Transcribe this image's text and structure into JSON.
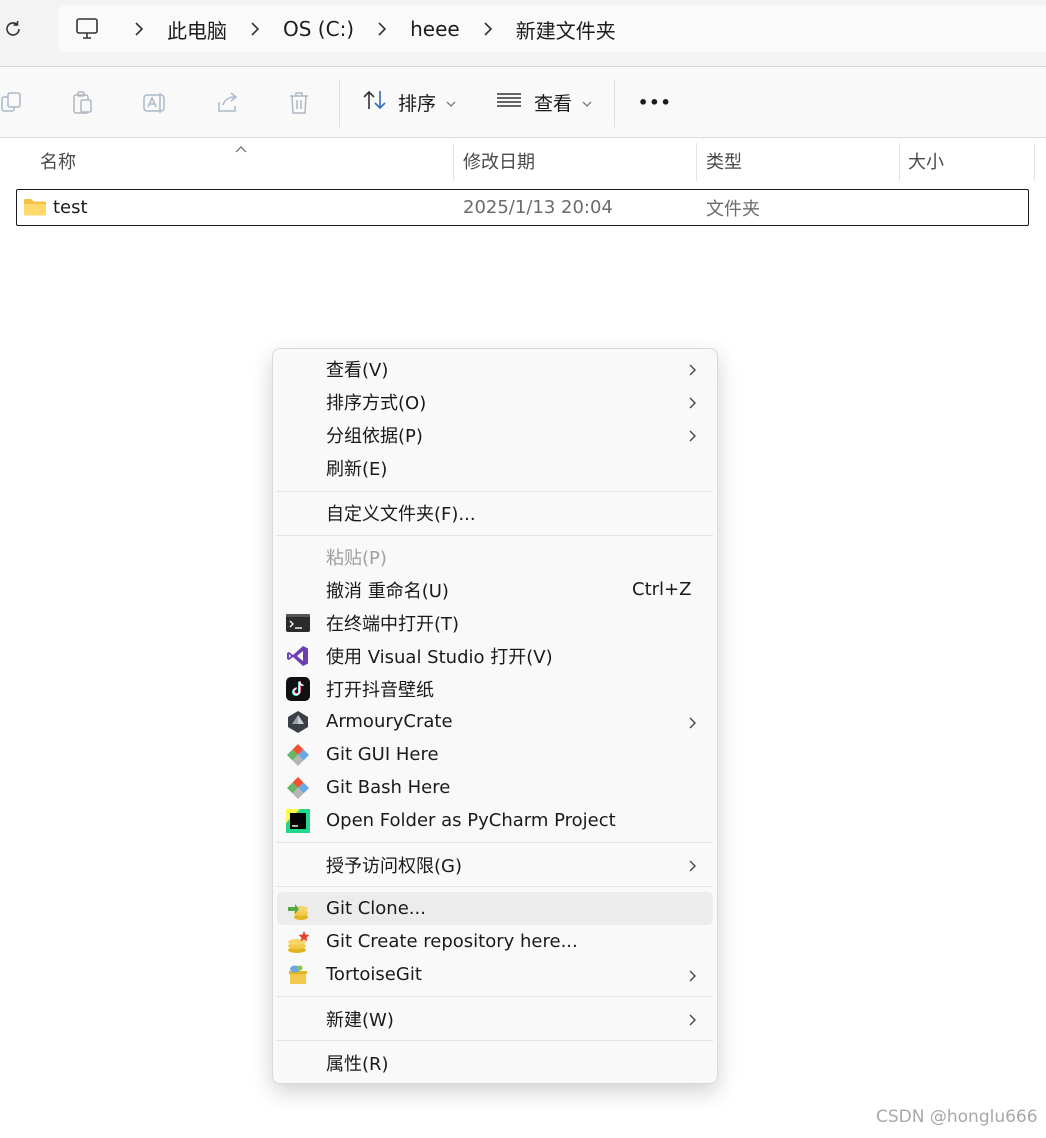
{
  "breadcrumb": {
    "icon": "computer-icon",
    "items": [
      "此电脑",
      "OS (C:)",
      "heee",
      "新建文件夹"
    ]
  },
  "toolbar": {
    "icons": [
      "copy-icon",
      "paste-icon",
      "rename-icon",
      "share-icon",
      "delete-icon"
    ],
    "sort_label": "排序",
    "view_label": "查看",
    "more_label": "•••"
  },
  "columns": {
    "name": "名称",
    "modified": "修改日期",
    "type": "类型",
    "size": "大小"
  },
  "files": [
    {
      "name": "test",
      "modified": "2025/1/13 20:04",
      "type": "文件夹",
      "size": ""
    }
  ],
  "context_menu": {
    "items": [
      {
        "label": "查看(V)",
        "submenu": true
      },
      {
        "label": "排序方式(O)",
        "submenu": true
      },
      {
        "label": "分组依据(P)",
        "submenu": true
      },
      {
        "label": "刷新(E)"
      },
      {
        "label": "自定义文件夹(F)..."
      },
      {
        "label": "粘贴(P)",
        "disabled": true
      },
      {
        "label": "撤消 重命名(U)",
        "shortcut": "Ctrl+Z"
      },
      {
        "label": "在终端中打开(T)",
        "icon": "terminal-icon"
      },
      {
        "label": "使用 Visual Studio 打开(V)",
        "icon": "visual-studio-icon"
      },
      {
        "label": "打开抖音壁纸",
        "icon": "douyin-icon"
      },
      {
        "label": "ArmouryCrate",
        "icon": "armoury-crate-icon",
        "submenu": true
      },
      {
        "label": "Git GUI Here",
        "icon": "git-icon"
      },
      {
        "label": "Git Bash Here",
        "icon": "git-icon"
      },
      {
        "label": "Open Folder as PyCharm Project",
        "icon": "pycharm-icon"
      },
      {
        "label": "授予访问权限(G)",
        "submenu": true
      },
      {
        "label": "Git Clone...",
        "icon": "tortoisegit-clone-icon",
        "highlighted": true
      },
      {
        "label": "Git Create repository here...",
        "icon": "tortoisegit-create-icon"
      },
      {
        "label": "TortoiseGit",
        "icon": "tortoisegit-icon",
        "submenu": true
      },
      {
        "label": "新建(W)",
        "submenu": true
      },
      {
        "label": "属性(R)"
      }
    ]
  },
  "watermark": "CSDN @honglu666"
}
